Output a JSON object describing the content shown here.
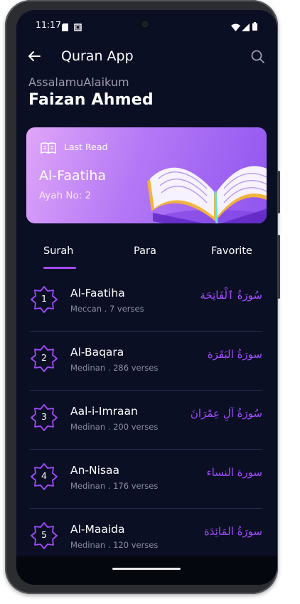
{
  "status": {
    "time": "11:17"
  },
  "appbar": {
    "title": "Quran App"
  },
  "greeting": {
    "salutation": "AssalamuAlaikum",
    "name": "Faizan Ahmed"
  },
  "last_read": {
    "label": "Last Read",
    "surah": "Al-Faatiha",
    "ayah": "Ayah No: 2"
  },
  "tabs": [
    {
      "label": "Surah",
      "active": true
    },
    {
      "label": "Para",
      "active": false
    },
    {
      "label": "Favorite",
      "active": false
    }
  ],
  "surahs": [
    {
      "number": "1",
      "name": "Al-Faatiha",
      "info": "Meccan . 7 verses",
      "arabic": "سُورَةُ ٱلْفَاتِحَة"
    },
    {
      "number": "2",
      "name": "Al-Baqara",
      "info": "Medinan . 286 verses",
      "arabic": "سورَةُ البَقَرَة"
    },
    {
      "number": "3",
      "name": "Aal-i-Imraan",
      "info": "Medinan . 200 verses",
      "arabic": "سُورَةُ آلِ عِمْرَانَ"
    },
    {
      "number": "4",
      "name": "An-Nisaa",
      "info": "Medinan . 176 verses",
      "arabic": "سورة النساء"
    },
    {
      "number": "5",
      "name": "Al-Maaida",
      "info": "Medinan . 120 verses",
      "arabic": "سورَةُ المَائِدَة"
    }
  ],
  "colors": {
    "background": "#0a0f24",
    "accent": "#a44aff",
    "card_start": "#e0a6f8",
    "card_end": "#8f55ef"
  }
}
